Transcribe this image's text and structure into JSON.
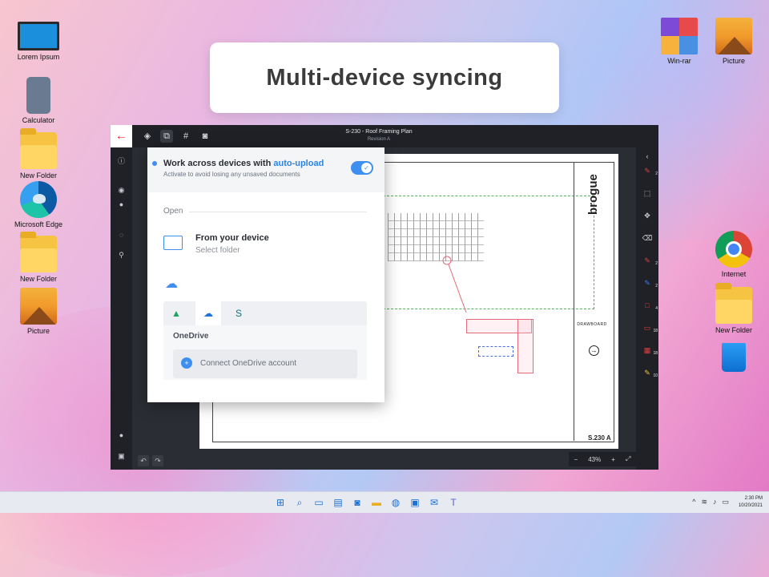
{
  "banner": {
    "title": "Multi-device syncing"
  },
  "desktop": {
    "left_icons": [
      "Lorem Ipsum",
      "Calculator",
      "New Folder",
      "Microsoft Edge",
      "New Folder",
      "Picture"
    ],
    "right_icons": [
      "Win-rar",
      "Picture",
      "Internet",
      "New Folder"
    ]
  },
  "app": {
    "doc_title": "S-230 - Roof Framing Plan",
    "revision": "Revision A",
    "zoom": "43%",
    "tool_counts": [
      "2",
      "2",
      "2",
      "4",
      "18",
      "18",
      "10"
    ]
  },
  "sheet": {
    "brand": "brogue",
    "company": "DRAWBOARD",
    "sheet_no": "S.230",
    "rev": "A"
  },
  "panel": {
    "heading_prefix": "Work across devices with ",
    "heading_highlight": "auto-upload",
    "subheading": "Activate to avoid losing any unsaved documents",
    "open_label": "Open",
    "device_title": "From your device",
    "device_sub": "Select folder",
    "service_label": "OneDrive",
    "connect_label": "Connect OneDrive account"
  },
  "taskbar": {
    "time": "2:30 PM",
    "date": "10/20/2021"
  },
  "colors": {
    "accent": "#3f8ff0",
    "markup_red": "#e36b7a",
    "app_dark": "#1f2126"
  }
}
